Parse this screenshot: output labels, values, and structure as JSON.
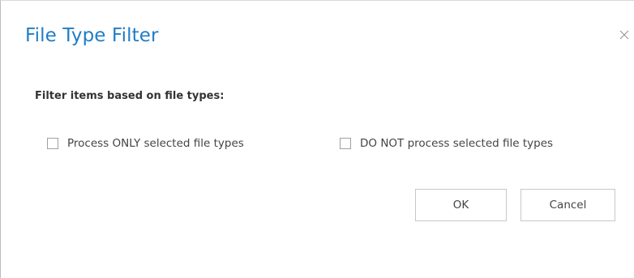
{
  "dialog": {
    "title": "File Type Filter",
    "close_icon": "close-icon",
    "section_label": "Filter items based on file types:",
    "options": [
      {
        "label": "Process ONLY selected file types",
        "checked": false
      },
      {
        "label": "DO NOT process selected file types",
        "checked": false
      }
    ],
    "buttons": {
      "ok_label": "OK",
      "cancel_label": "Cancel"
    }
  },
  "colors": {
    "title": "#1f7dc7",
    "text": "#444444",
    "border": "#c8c8c8"
  }
}
